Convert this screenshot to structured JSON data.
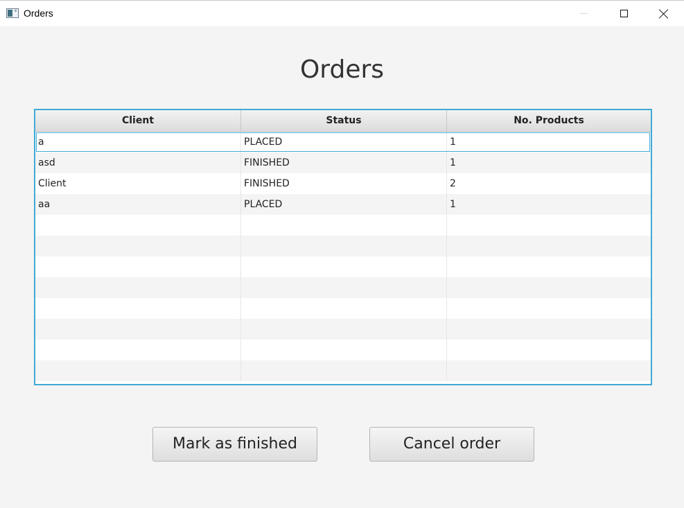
{
  "window": {
    "title": "Orders",
    "controls": [
      "minimize-icon",
      "maximize-icon",
      "close-icon"
    ]
  },
  "page": {
    "title": "Orders"
  },
  "table": {
    "columns": [
      "Client",
      "Status",
      "No. Products"
    ],
    "rows": [
      [
        "a",
        "PLACED",
        "1"
      ],
      [
        "asd",
        "FINISHED",
        "1"
      ],
      [
        "Client",
        "FINISHED",
        "2"
      ],
      [
        "aa",
        "PLACED",
        "1"
      ]
    ],
    "selected_row": 0,
    "accent_color": "#3fa9d5"
  },
  "buttons": {
    "mark_finished": "Mark as finished",
    "cancel_order": "Cancel order"
  }
}
